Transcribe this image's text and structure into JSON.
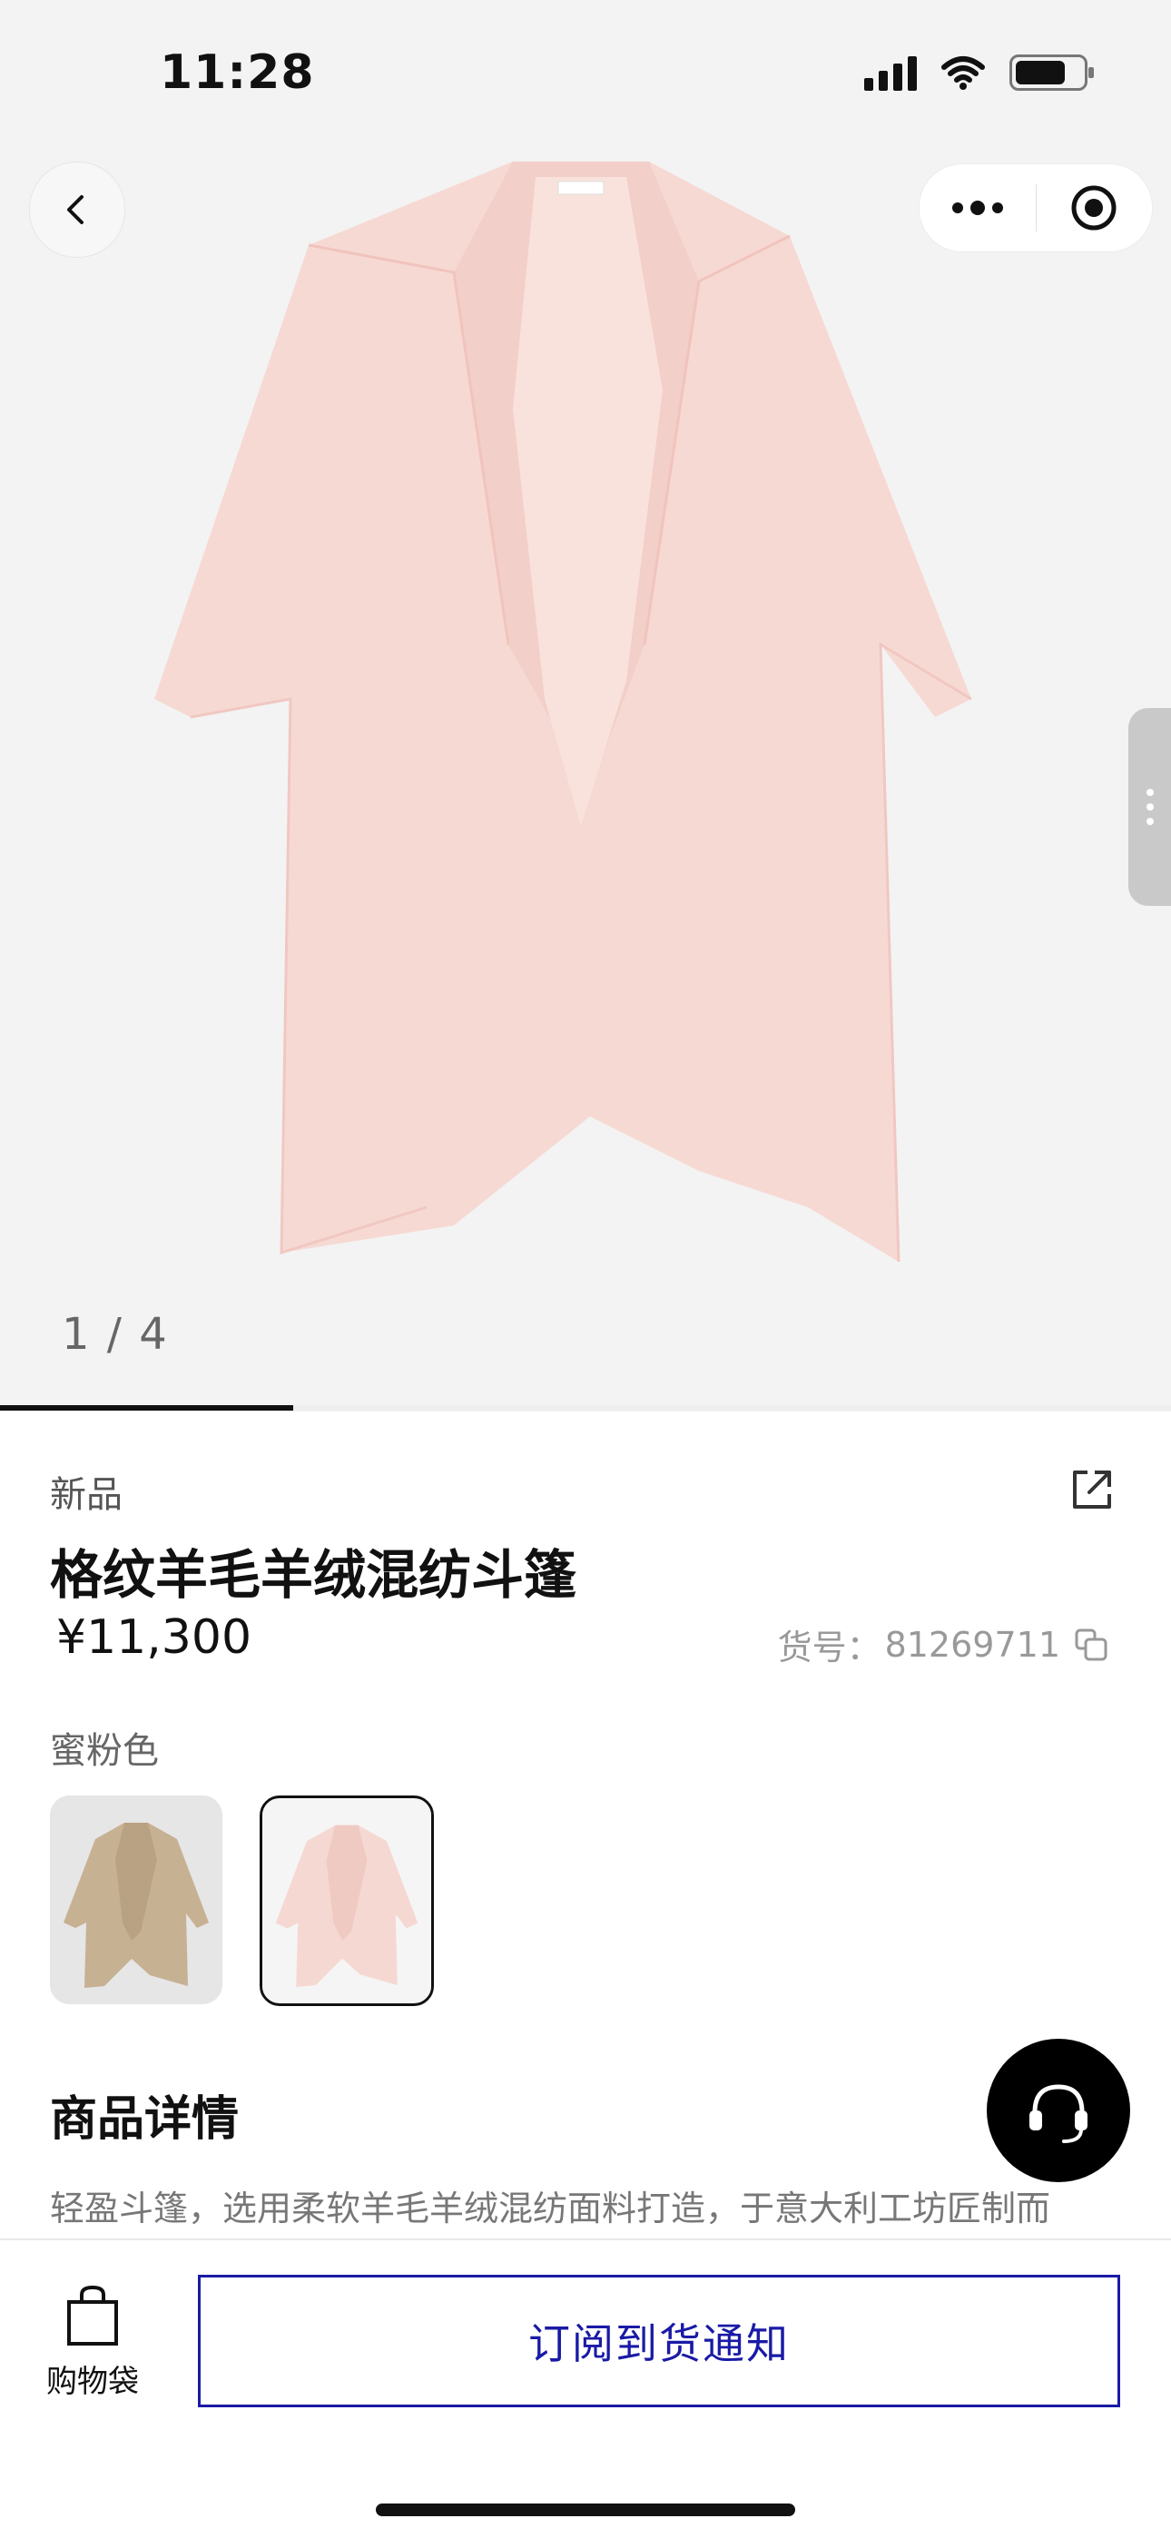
{
  "status_bar": {
    "time": "11:28"
  },
  "gallery": {
    "page_indicator": "1 / 4",
    "progress_fraction": 0.25
  },
  "product": {
    "tag": "新品",
    "title": "格纹羊毛羊绒混纺斗篷",
    "price": "¥11,300",
    "sku_label": "货号：",
    "sku_value": "81269711",
    "color_label": "蜜粉色",
    "swatches": [
      {
        "color": "#c9b497",
        "selected": false
      },
      {
        "color": "#f4d5cf",
        "selected": true
      }
    ]
  },
  "details": {
    "title": "商品详情",
    "text": "轻盈斗篷，选用柔软羊毛羊绒混纺面料打造，于意大利工坊匠制而"
  },
  "bottom_bar": {
    "cart_label": "购物袋",
    "notify_label": "订阅到货通知"
  },
  "icons": {
    "back": "chevron-left-icon",
    "more": "more-dots-icon",
    "target": "record-target-icon",
    "share": "share-external-icon",
    "copy": "copy-icon",
    "support": "headset-icon",
    "bag": "shopping-bag-icon"
  },
  "colors": {
    "accent": "#1a1aa6",
    "cape_primary": "#f6d6d0"
  }
}
